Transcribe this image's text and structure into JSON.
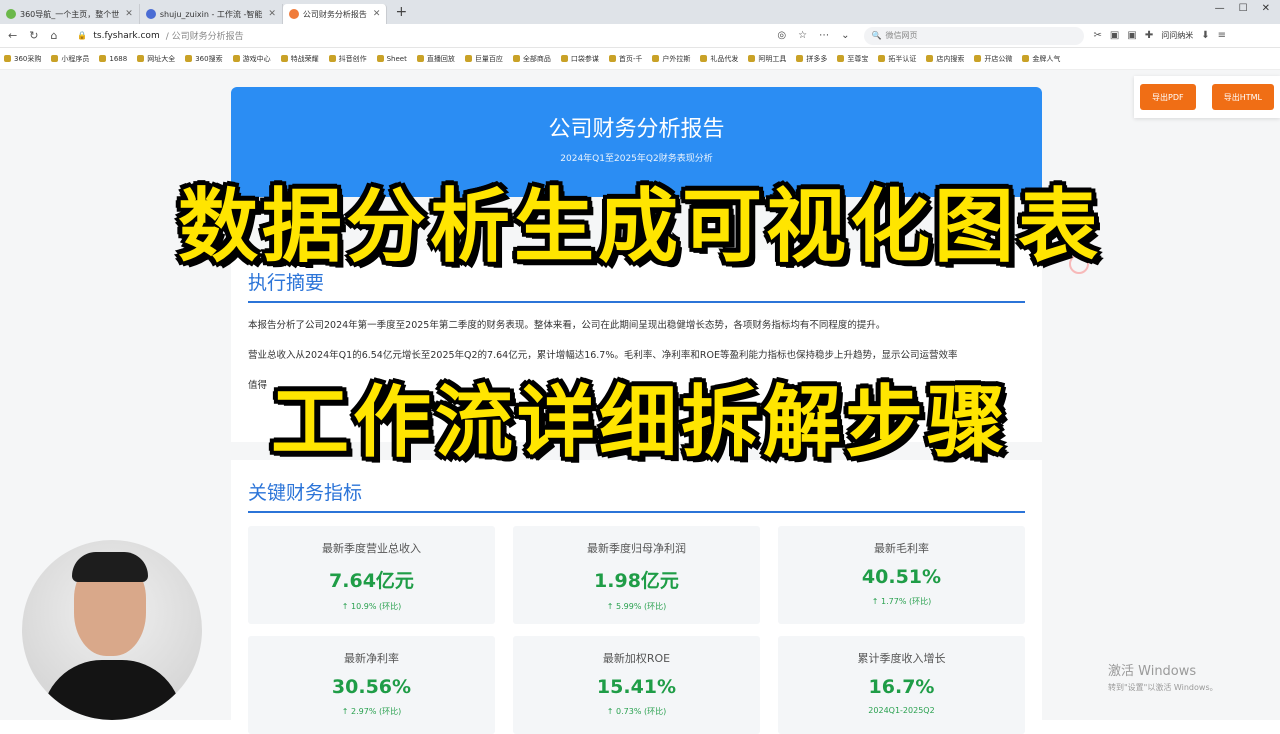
{
  "browser": {
    "tabs": [
      {
        "label": "360导航_一个主页，整个世"
      },
      {
        "label": "shuju_zuixin - 工作流 -智能"
      },
      {
        "label": "公司财务分析报告"
      }
    ],
    "new_tab": "+",
    "url_host": "ts.fyshark.com",
    "url_path": "/ 公司财务分析报告",
    "search_placeholder": "微信网页",
    "profile_label": "问问纳米",
    "bookmarks": [
      "360采购",
      "小程序员",
      "1688",
      "网址大全",
      "360搜索",
      "游戏中心",
      "特战荣耀",
      "抖音创作",
      "Sheet",
      "直播回放",
      "巨量百应",
      "全部商品",
      "口袋参谋",
      "首页-千",
      "户外拉斯",
      "礼品代发",
      "阿明工具",
      "拼多多",
      "至尊宝",
      "拓半认证",
      "店内搜索",
      "开店公微",
      "金牌人气"
    ]
  },
  "export": {
    "pdf_label": "导出PDF",
    "html_label": "导出HTML"
  },
  "header": {
    "title": "公司财务分析报告",
    "subtitle": "2024年Q1至2025年Q2财务表现分析"
  },
  "summary": {
    "heading": "执行摘要",
    "p1": "本报告分析了公司2024年第一季度至2025年第二季度的财务表现。整体来看，公司在此期间呈现出稳健增长态势，各项财务指标均有不同程度的提升。",
    "p2": "营业总收入从2024年Q1的6.54亿元增长至2025年Q2的7.64亿元，累计增幅达16.7%。毛利率、净利率和ROE等盈利能力指标也保持稳步上升趋势，显示公司运营效率",
    "p3": "值得"
  },
  "kpi": {
    "heading": "关键财务指标",
    "items": [
      {
        "label": "最新季度营业总收入",
        "value": "7.64亿元",
        "change": "↑ 10.9% (环比)"
      },
      {
        "label": "最新季度归母净利润",
        "value": "1.98亿元",
        "change": "↑ 5.99% (环比)"
      },
      {
        "label": "最新毛利率",
        "value": "40.51%",
        "change": "↑ 1.77% (环比)"
      },
      {
        "label": "最新净利率",
        "value": "30.56%",
        "change": "↑ 2.97% (环比)"
      },
      {
        "label": "最新加权ROE",
        "value": "15.41%",
        "change": "↑ 0.73% (环比)"
      },
      {
        "label": "累计季度收入增长",
        "value": "16.7%",
        "change": "2024Q1-2025Q2"
      }
    ]
  },
  "overlay": {
    "line1": "数据分析生成可视化图表",
    "line2": "工作流详细拆解步骤"
  },
  "watermark": {
    "line1": "激活 Windows",
    "line2": "转到\"设置\"以激活 Windows。"
  }
}
